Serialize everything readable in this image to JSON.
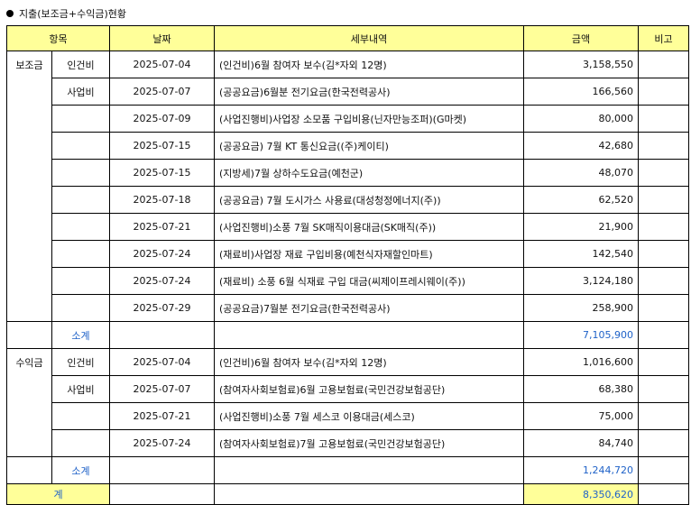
{
  "title": "지출(보조금+수익금)현황",
  "headers": {
    "item": "항목",
    "date": "날짜",
    "detail": "세부내역",
    "amount": "금액",
    "note": "비고"
  },
  "groups": [
    {
      "category": "보조금",
      "rows": [
        {
          "sub": "인건비",
          "date": "2025-07-04",
          "detail": "(인건비)6월 참여자 보수(김*자외 12명)",
          "amount": "3,158,550"
        },
        {
          "sub": "사업비",
          "date": "2025-07-07",
          "detail": "(공공요금)6월분 전기요금(한국전력공사)",
          "amount": "166,560"
        },
        {
          "sub": "",
          "date": "2025-07-09",
          "detail": "(사업진행비)사업장 소모품 구입비용(닌자만능조퍼)(G마켓)",
          "amount": "80,000"
        },
        {
          "sub": "",
          "date": "2025-07-15",
          "detail": "(공공요금) 7월 KT 통신요금((주)케이티)",
          "amount": "42,680"
        },
        {
          "sub": "",
          "date": "2025-07-15",
          "detail": "(지방세)7월 상하수도요금(예천군)",
          "amount": "48,070"
        },
        {
          "sub": "",
          "date": "2025-07-18",
          "detail": "(공공요금) 7월 도시가스 사용료(대성청정에너지(주))",
          "amount": "62,520"
        },
        {
          "sub": "",
          "date": "2025-07-21",
          "detail": "(사업진행비)소풍 7월 SK매직이용대금(SK매직(주))",
          "amount": "21,900"
        },
        {
          "sub": "",
          "date": "2025-07-24",
          "detail": "(재료비)사업장 재료 구입비용(예천식자재할인마트)",
          "amount": "142,540"
        },
        {
          "sub": "",
          "date": "2025-07-24",
          "detail": "(재료비) 소풍 6월 식재료 구입 대금(씨제이프레시웨이(주))",
          "amount": "3,124,180"
        },
        {
          "sub": "",
          "date": "2025-07-29",
          "detail": "(공공요금)7월분 전기요금(한국전력공사)",
          "amount": "258,900"
        }
      ],
      "subtotal_label": "소계",
      "subtotal": "7,105,900"
    },
    {
      "category": "수익금",
      "rows": [
        {
          "sub": "인건비",
          "date": "2025-07-04",
          "detail": "(인건비)6월 참여자 보수(김*자외 12명)",
          "amount": "1,016,600"
        },
        {
          "sub": "사업비",
          "date": "2025-07-07",
          "detail": "(참여자사회보험료)6월 고용보험료(국민건강보험공단)",
          "amount": "68,380"
        },
        {
          "sub": "",
          "date": "2025-07-21",
          "detail": "(사업진행비)소풍 7월 세스코 이용대금(세스코)",
          "amount": "75,000"
        },
        {
          "sub": "",
          "date": "2025-07-24",
          "detail": "(참여자사회보험료)7월 고용보험료(국민건강보험공단)",
          "amount": "84,740"
        }
      ],
      "subtotal_label": "소계",
      "subtotal": "1,244,720"
    }
  ],
  "total_label": "계",
  "total": "8,350,620"
}
